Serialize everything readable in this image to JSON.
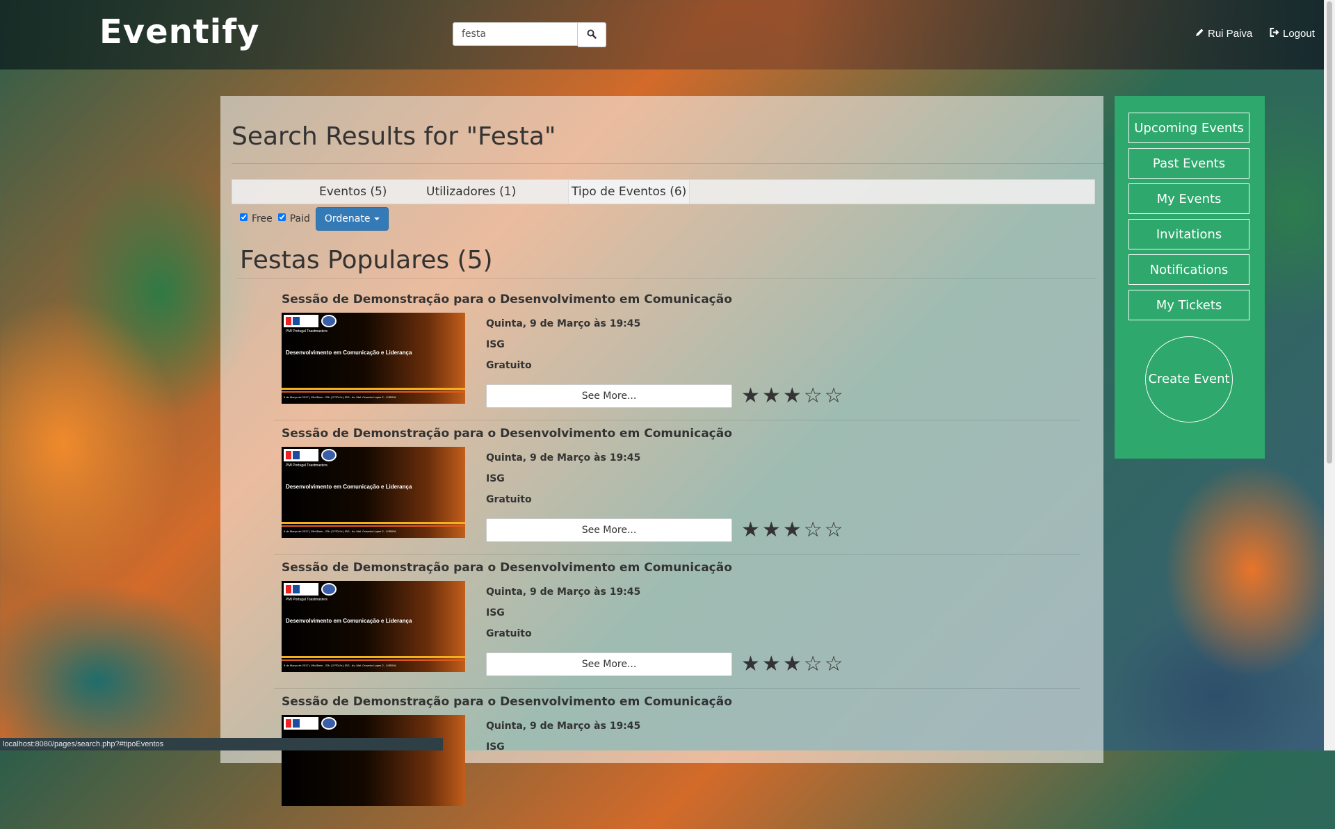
{
  "app": {
    "brand": "Eventify"
  },
  "navbar": {
    "search_value": "festa",
    "search_icon": "search-icon",
    "user_label": "Rui Paiva",
    "user_icon": "pencil-icon",
    "logout_label": "Logout",
    "logout_icon": "logout-icon"
  },
  "page": {
    "title": "Search Results for \"Festa\""
  },
  "tabs": [
    {
      "label": "Eventos (5)"
    },
    {
      "label": "Utilizadores (1)"
    },
    {
      "label": "Tipo de Eventos (6)",
      "active": true
    }
  ],
  "filters": {
    "free_label": "Free",
    "free_checked": true,
    "paid_label": "Paid",
    "paid_checked": true,
    "ordenate_label": "Ordenate"
  },
  "section": {
    "title": "Festas Populares (5)"
  },
  "events": [
    {
      "title": "Sessão de Demonstração para o Desenvolvimento em Comunicação",
      "date": "Quinta, 9 de Março às 19:45",
      "location": "ISG",
      "price": "Gratuito",
      "see_more": "See More...",
      "rating": 3,
      "rating_max": 5,
      "image": {
        "subtitle": "PMI Portugal Toastmasters",
        "heading": "Desenvolvimento em Comunicação e Liderança",
        "footer": "9 de Março de 2017 | 19h45min - 22h | 2 PDU's | ISG - Av. Mal. Craveiro Lopes 2 - LISBOA"
      }
    },
    {
      "title": "Sessão de Demonstração para o Desenvolvimento em Comunicação",
      "date": "Quinta, 9 de Março às 19:45",
      "location": "ISG",
      "price": "Gratuito",
      "see_more": "See More...",
      "rating": 3,
      "rating_max": 5,
      "image": {
        "subtitle": "PMI Portugal Toastmasters",
        "heading": "Desenvolvimento em Comunicação e Liderança",
        "footer": "9 de Março de 2017 | 19h45min - 22h | 2 PDU's | ISG - Av. Mal. Craveiro Lopes 2 - LISBOA"
      }
    },
    {
      "title": "Sessão de Demonstração para o Desenvolvimento em Comunicação",
      "date": "Quinta, 9 de Março às 19:45",
      "location": "ISG",
      "price": "Gratuito",
      "see_more": "See More...",
      "rating": 3,
      "rating_max": 5,
      "image": {
        "subtitle": "PMI Portugal Toastmasters",
        "heading": "Desenvolvimento em Comunicação e Liderança",
        "footer": "9 de Março de 2017 | 19h45min - 22h | 2 PDU's | ISG - Av. Mal. Craveiro Lopes 2 - LISBOA"
      }
    },
    {
      "title": "Sessão de Demonstração para o Desenvolvimento em Comunicação",
      "date": "Quinta, 9 de Março às 19:45",
      "location": "ISG",
      "price": "",
      "see_more": "",
      "rating": 0,
      "rating_max": 0,
      "image": {
        "subtitle": "",
        "heading": "",
        "footer": ""
      }
    }
  ],
  "sidebar": {
    "items": [
      {
        "label": "Upcoming Events"
      },
      {
        "label": "Past Events"
      },
      {
        "label": "My Events"
      },
      {
        "label": "Invitations"
      },
      {
        "label": "Notifications"
      },
      {
        "label": "My Tickets"
      }
    ],
    "create_label": "Create Event"
  },
  "statusbar": {
    "url": "localhost:8080/pages/search.php?#tipoEventos"
  },
  "colors": {
    "accent_green": "#2ea86c",
    "primary_blue": "#337ab7"
  }
}
